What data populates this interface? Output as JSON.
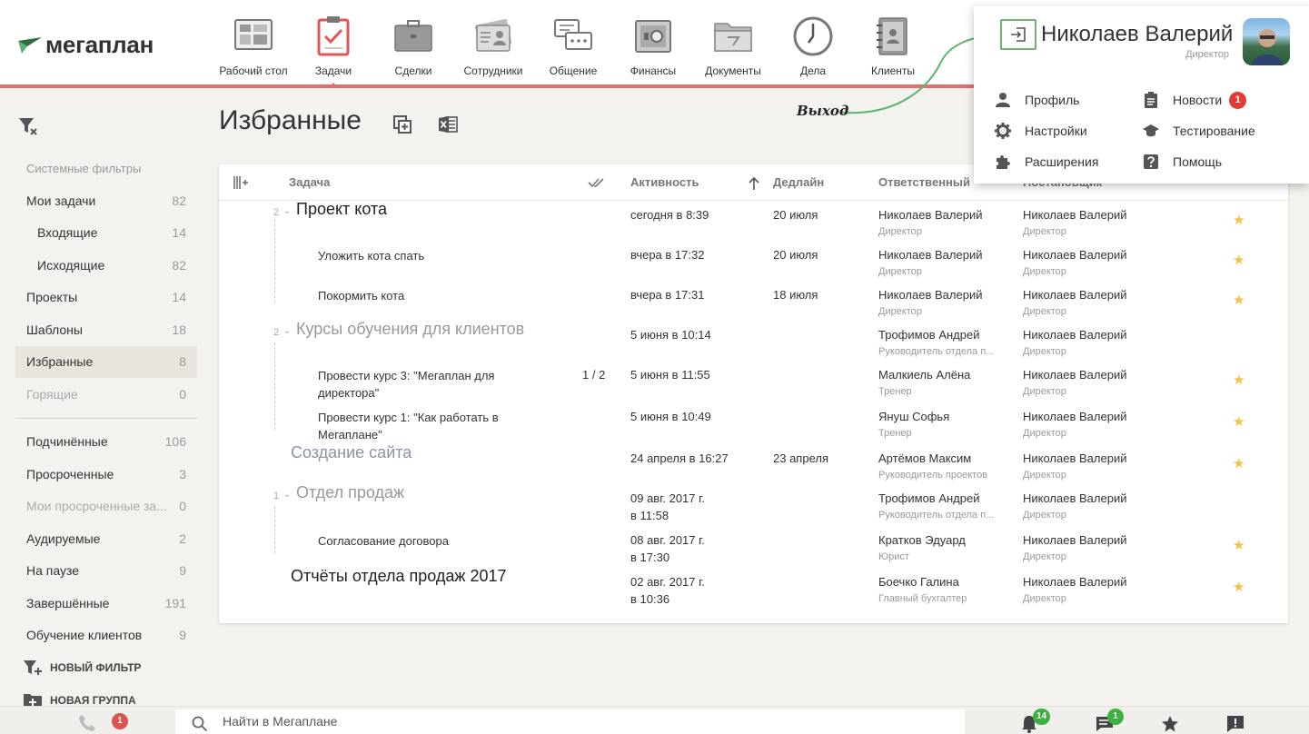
{
  "app": {
    "logo_text": "мегаплан"
  },
  "nav": [
    {
      "label": "Рабочий стол",
      "icon": "dashboard-icon"
    },
    {
      "label": "Задачи",
      "icon": "tasks-clipboard-icon",
      "active": true
    },
    {
      "label": "Сделки",
      "icon": "briefcase-icon"
    },
    {
      "label": "Сотрудники",
      "icon": "employees-card-icon"
    },
    {
      "label": "Общение",
      "icon": "chat-icon"
    },
    {
      "label": "Финансы",
      "icon": "safe-icon"
    },
    {
      "label": "Документы",
      "icon": "folder-icon"
    },
    {
      "label": "Дела",
      "icon": "clock-icon"
    },
    {
      "label": "Клиенты",
      "icon": "address-book-icon"
    }
  ],
  "sidebar": {
    "section_title": "Системные фильтры",
    "items": [
      {
        "label": "Мои задачи",
        "count": "82"
      },
      {
        "label": "Входящие",
        "count": "14",
        "sub": true
      },
      {
        "label": "Исходящие",
        "count": "82",
        "sub": true
      },
      {
        "label": "Проекты",
        "count": "14"
      },
      {
        "label": "Шаблоны",
        "count": "18"
      },
      {
        "label": "Избранные",
        "count": "8",
        "active": true
      },
      {
        "label": "Горящие",
        "count": "0",
        "muted": true
      }
    ],
    "items2": [
      {
        "label": "Подчинённые",
        "count": "106"
      },
      {
        "label": "Просроченные",
        "count": "3"
      },
      {
        "label": "Мои просроченные за...",
        "count": "0",
        "muted": true
      },
      {
        "label": "Аудируемые",
        "count": "2"
      },
      {
        "label": "На паузе",
        "count": "9"
      },
      {
        "label": "Завершённые",
        "count": "191"
      },
      {
        "label": "Обучение клиентов",
        "count": "9"
      }
    ],
    "new_filter": "НОВЫЙ ФИЛЬТР",
    "new_group": "НОВАЯ ГРУППА"
  },
  "main": {
    "title": "Избранные",
    "columns": {
      "task": "Задача",
      "activity": "Активность",
      "deadline": "Дедлайн",
      "responsible": "Ответственный",
      "author": "Постановщик"
    }
  },
  "rows": [
    {
      "num": "2",
      "name": "Проект кота",
      "kind": "project",
      "activity": [
        "сегодня в 8:39"
      ],
      "deadline": "20 июля",
      "resp": "Николаев Валерий",
      "resp_role": "Директор",
      "author": "Николаев Валерий",
      "author_role": "Директор",
      "star": true
    },
    {
      "name": "Уложить кота спать",
      "kind": "child",
      "activity": [
        "вчера в 17:32"
      ],
      "deadline": "20 июля",
      "resp": "Николаев Валерий",
      "resp_role": "Директор",
      "author": "Николаев Валерий",
      "author_role": "Директор",
      "star": true
    },
    {
      "name": "Покормить кота",
      "kind": "child",
      "activity": [
        "вчера в 17:31"
      ],
      "deadline": "18 июля",
      "resp": "Николаев Валерий",
      "resp_role": "Директор",
      "author": "Николаев Валерий",
      "author_role": "Директор",
      "star": true
    },
    {
      "num": "2",
      "name": "Курсы обучения для клиентов",
      "kind": "project done",
      "activity": [
        "5 июня в 10:14"
      ],
      "deadline": "",
      "resp": "Трофимов Андрей",
      "resp_role": "Руководитель отдела п...",
      "author": "Николаев Валерий",
      "author_role": "Директор",
      "star": false
    },
    {
      "name": "Провести курс 3: \"Мегаплан для директора\"",
      "kind": "child",
      "subtasks": "1 / 2",
      "activity": [
        "5 июня в 11:55"
      ],
      "deadline": "",
      "resp": "Малкиель Алёна",
      "resp_role": "Тренер",
      "author": "Николаев Валерий",
      "author_role": "Директор",
      "star": true
    },
    {
      "name": "Провести курс 1: \"Как работать в Мегаплане\"",
      "kind": "child",
      "activity": [
        "5 июня в 10:49"
      ],
      "deadline": "",
      "resp": "Януш Софья",
      "resp_role": "Тренер",
      "author": "Николаев Валерий",
      "author_role": "Директор",
      "star": true
    },
    {
      "name": "Создание сайта",
      "kind": "project muted",
      "activity": [
        "24 апреля в 16:27"
      ],
      "deadline": "23 апреля",
      "resp": "Артёмов Максим",
      "resp_role": "Руководитель проектов",
      "author": "Николаев Валерий",
      "author_role": "Директор",
      "star": true
    },
    {
      "num": "1",
      "name": "Отдел продаж",
      "kind": "project done",
      "activity": [
        "09 авг. 2017 г.",
        "в 11:58"
      ],
      "deadline": "",
      "resp": "Трофимов Андрей",
      "resp_role": "Руководитель отдела п...",
      "author": "Николаев Валерий",
      "author_role": "Директор",
      "star": false
    },
    {
      "name": "Согласование договора",
      "kind": "child",
      "activity": [
        "08 авг. 2017 г.",
        "в 17:30"
      ],
      "deadline": "",
      "resp": "Кратков Эдуард",
      "resp_role": "Юрист",
      "author": "Николаев Валерий",
      "author_role": "Директор",
      "star": true
    },
    {
      "name": "Отчёты отдела продаж 2017",
      "kind": "project",
      "activity": [
        "02 авг. 2017 г.",
        "в 10:36"
      ],
      "deadline": "",
      "resp": "Боечко Галина",
      "resp_role": "Главный бухгалтер",
      "author": "Николаев Валерий",
      "author_role": "Директор",
      "star": true
    }
  ],
  "profile": {
    "name": "Николаев Валерий",
    "role": "Директор",
    "menu_left": [
      {
        "label": "Профиль",
        "icon": "person-icon"
      },
      {
        "label": "Настройки",
        "icon": "gear-icon"
      },
      {
        "label": "Расширения",
        "icon": "puzzle-icon"
      }
    ],
    "menu_right": [
      {
        "label": "Новости",
        "icon": "news-clipboard-icon",
        "badge": "1"
      },
      {
        "label": "Тестирование",
        "icon": "graduation-cap-icon"
      },
      {
        "label": "Помощь",
        "icon": "help-icon"
      }
    ]
  },
  "annotation": {
    "label": "Выход"
  },
  "bottom": {
    "calls_badge": "1",
    "search_placeholder": "Найти в Мегаплане",
    "notifications_badge": "14",
    "messages_badge": "1"
  },
  "colors": {
    "accent_red": "#e86d6d",
    "green": "#3cb043",
    "star": "#f5c242",
    "active_bg": "#e9e5dc"
  }
}
